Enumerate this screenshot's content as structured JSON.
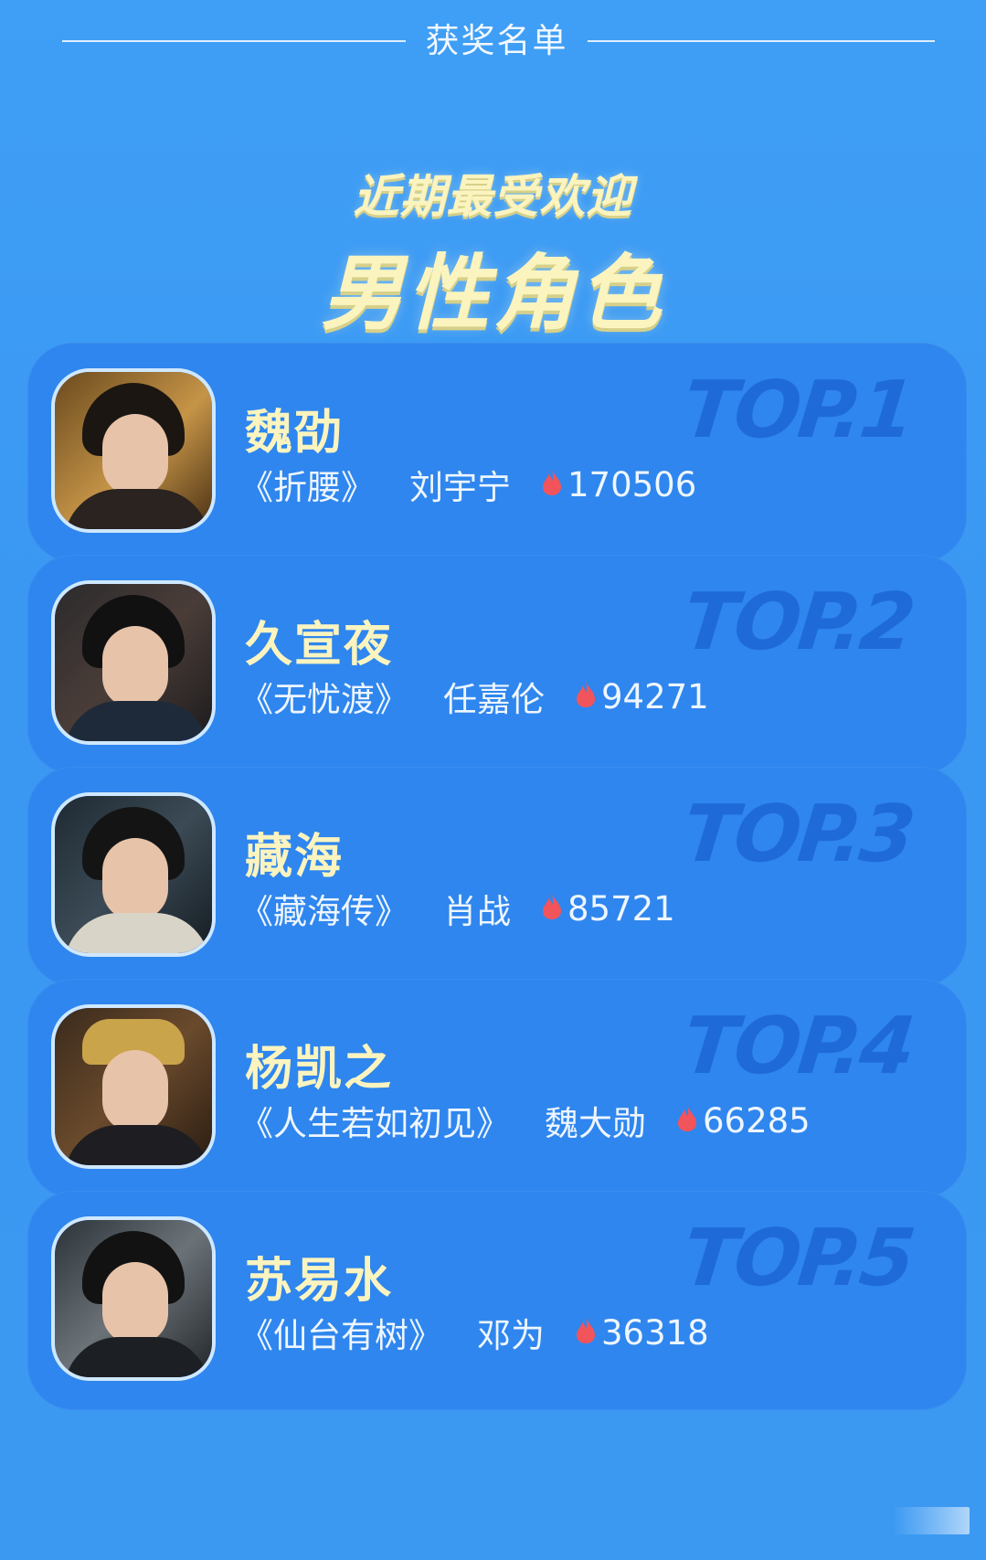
{
  "header": {
    "label": "获奖名单"
  },
  "title": {
    "line1": "近期最受欢迎",
    "line2": "男性角色"
  },
  "colors": {
    "background": "#3b99f2",
    "card": "#2f86ee",
    "title": "#fbf4bf",
    "rank": "#1f6ad9",
    "flame": "#f2545b"
  },
  "entries": [
    {
      "name": "魏劭",
      "work": "《折腰》",
      "actor": "刘宇宁",
      "heat": "170506",
      "rank": "TOP.1"
    },
    {
      "name": "久宣夜",
      "work": "《无忧渡》",
      "actor": "任嘉伦",
      "heat": "94271",
      "rank": "TOP.2"
    },
    {
      "name": "藏海",
      "work": "《藏海传》",
      "actor": "肖战",
      "heat": "85721",
      "rank": "TOP.3"
    },
    {
      "name": "杨凯之",
      "work": "《人生若如初见》",
      "actor": "魏大勋",
      "heat": "66285",
      "rank": "TOP.4"
    },
    {
      "name": "苏易水",
      "work": "《仙台有树》",
      "actor": "邓为",
      "heat": "36318",
      "rank": "TOP.5"
    }
  ]
}
